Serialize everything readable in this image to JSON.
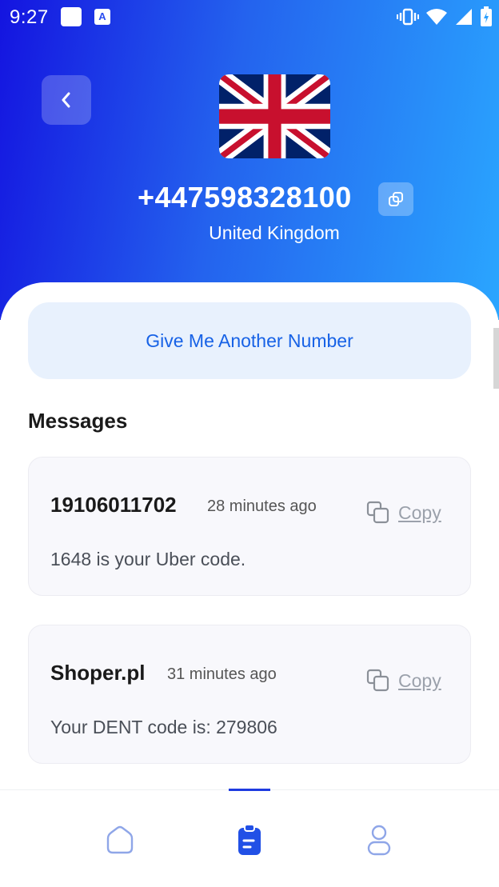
{
  "status_bar": {
    "time": "9:27"
  },
  "header": {
    "phone_number": "+447598328100",
    "country": "United Kingdom"
  },
  "actions": {
    "another_number_label": "Give Me Another Number"
  },
  "messages": {
    "title": "Messages",
    "items": [
      {
        "sender": "19106011702",
        "time": "28 minutes ago",
        "copy_label": "Copy",
        "text": "1648 is your Uber code."
      },
      {
        "sender": "Shoper.pl",
        "time": "31 minutes ago",
        "copy_label": "Copy",
        "text": "Your DENT code is: 279806"
      }
    ]
  },
  "bottom_nav": {
    "items": [
      {
        "icon": "home-icon",
        "active": false
      },
      {
        "icon": "clipboard-icon",
        "active": true
      },
      {
        "icon": "profile-icon",
        "active": false
      }
    ]
  },
  "colors": {
    "accent": "#1762e6",
    "header_gradient_start": "#1414e0",
    "header_gradient_end": "#2aa6ff"
  }
}
